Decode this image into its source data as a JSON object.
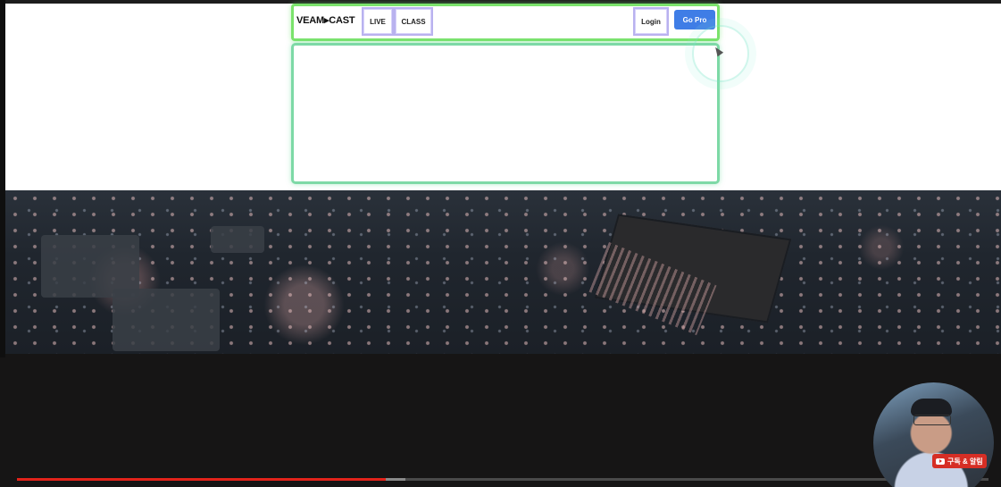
{
  "site": {
    "brand": "VEAM▸CAST",
    "nav": {
      "live": "LIVE",
      "class": "CLASS",
      "login": "Login",
      "go_pro": "Go Pro"
    }
  },
  "video": {
    "played_fraction": 0.38,
    "buffered_fraction": 0.4,
    "colors": {
      "played": "#e2231a",
      "buffer": "#8a8a8a",
      "track": "#4a4a4a"
    }
  },
  "overlay": {
    "subscribe_badge": "구독 & 알림",
    "badge_icon": "youtube-play-icon"
  },
  "highlights": {
    "nav_outline_color": "#7be36c",
    "content_outline_color": "#7dd9a6"
  }
}
